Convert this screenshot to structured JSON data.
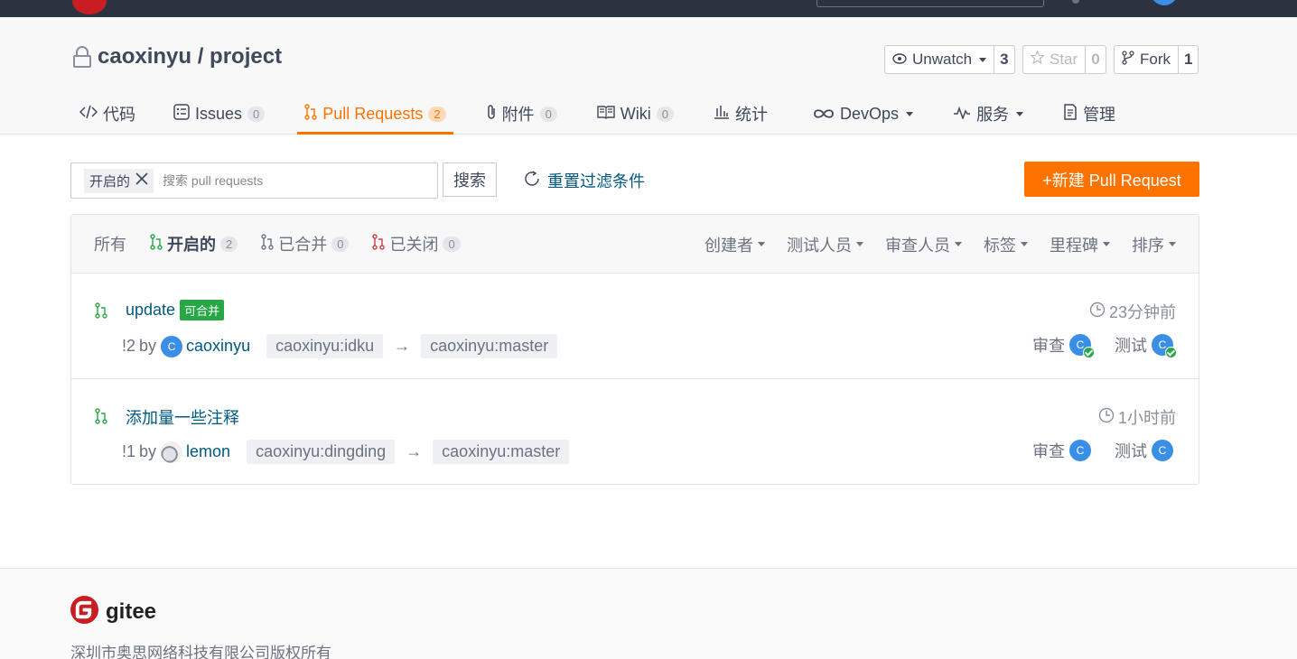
{
  "repo": {
    "title": "caoxinyu / project",
    "watch": {
      "label": "Unwatch",
      "count": "3"
    },
    "star": {
      "label": "Star",
      "count": "0"
    },
    "fork": {
      "label": "Fork",
      "count": "1"
    }
  },
  "tabs": [
    {
      "label": "代码",
      "icon": "code-icon"
    },
    {
      "label": "Issues",
      "badge": "0",
      "icon": "issues-icon"
    },
    {
      "label": "Pull Requests",
      "badge": "2",
      "icon": "pull-request-icon",
      "active": true
    },
    {
      "label": "附件",
      "badge": "0",
      "icon": "paperclip-icon"
    },
    {
      "label": "Wiki",
      "badge": "0",
      "icon": "book-icon"
    },
    {
      "label": "统计",
      "icon": "bar-chart-icon"
    },
    {
      "label": "DevOps",
      "icon": "infinity-icon"
    },
    {
      "label": "服务",
      "icon": "pulse-icon"
    },
    {
      "label": "管理",
      "icon": "document-icon"
    }
  ],
  "filter": {
    "chip": "开启的",
    "placeholder": "搜索 pull requests",
    "search_label": "搜索",
    "reset_label": "重置过滤条件",
    "new_label": "+新建 Pull Request"
  },
  "states": [
    {
      "label": "所有"
    },
    {
      "label": "开启的",
      "badge": "2",
      "color": "#28a745"
    },
    {
      "label": "已合并",
      "badge": "0",
      "color": "#6b7280"
    },
    {
      "label": "已关闭",
      "badge": "0",
      "color": "#d73a49"
    }
  ],
  "filters": [
    "创建者",
    "测试人员",
    "审查人员",
    "标签",
    "里程碑",
    "排序"
  ],
  "pulls": [
    {
      "title": "update",
      "status": "可合并",
      "number": "!2",
      "by": "by",
      "author": "caoxinyu",
      "author_initial": "C",
      "source": "caoxinyu:idku",
      "arrow": "→",
      "target": "caoxinyu:master",
      "time": "23分钟前",
      "review_label": "审查",
      "review_initial": "C",
      "test_label": "测试",
      "test_initial": "C"
    },
    {
      "title": "添加量一些注释",
      "number": "!1",
      "by": "by",
      "author": "lemon",
      "source": "caoxinyu:dingding",
      "arrow": "→",
      "target": "caoxinyu:master",
      "time": "1小时前",
      "review_label": "审查",
      "review_initial": "C",
      "test_label": "测试",
      "test_initial": "C"
    }
  ],
  "footer": {
    "brand": "gitee",
    "copyright": "深圳市奥思网络科技有限公司版权所有"
  },
  "colors": {
    "accent": "#fe7300",
    "link": "#005980",
    "open": "#28a745",
    "closed": "#d73a49"
  }
}
